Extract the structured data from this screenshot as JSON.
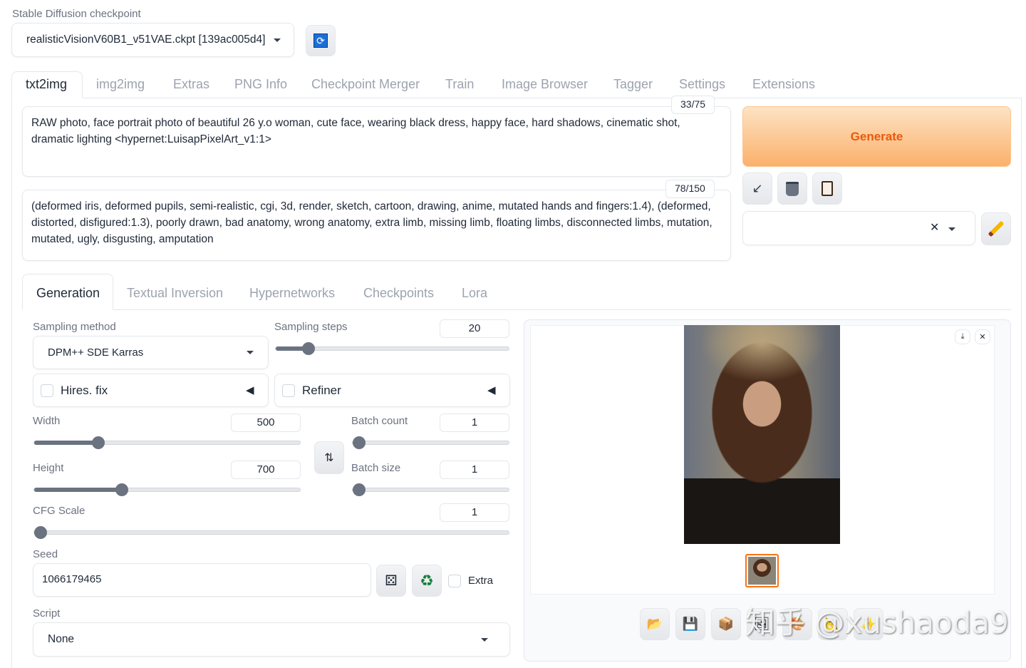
{
  "checkpoint": {
    "label": "Stable Diffusion checkpoint",
    "value": "realisticVisionV60B1_v51VAE.ckpt [139ac005d4]"
  },
  "tabs": [
    "txt2img",
    "img2img",
    "Extras",
    "PNG Info",
    "Checkpoint Merger",
    "Train",
    "Image Browser",
    "Tagger",
    "Settings",
    "Extensions"
  ],
  "prompt": {
    "text": "RAW photo, face portrait photo of beautiful 26 y.o woman, cute face, wearing black dress, happy face, hard shadows, cinematic shot, dramatic lighting <hypernet:LuisapPixelArt_v1:1>",
    "counter": "33/75"
  },
  "negative": {
    "text": "(deformed iris, deformed pupils, semi-realistic, cgi, 3d, render, sketch, cartoon, drawing, anime, mutated hands and fingers:1.4), (deformed, distorted, disfigured:1.3), poorly drawn, bad anatomy, wrong anatomy, extra limb, missing limb, floating limbs, disconnected limbs, mutation, mutated, ugly, disgusting, amputation",
    "counter": "78/150"
  },
  "generate_label": "Generate",
  "subtabs": [
    "Generation",
    "Textual Inversion",
    "Hypernetworks",
    "Checkpoints",
    "Lora"
  ],
  "sampling": {
    "method_label": "Sampling method",
    "method": "DPM++ SDE Karras",
    "steps_label": "Sampling steps",
    "steps": "20",
    "steps_frac": 0.14
  },
  "hires_label": "Hires. fix",
  "refiner_label": "Refiner",
  "width": {
    "label": "Width",
    "value": "500",
    "frac": 0.24
  },
  "height": {
    "label": "Height",
    "value": "700",
    "frac": 0.33
  },
  "batch_count": {
    "label": "Batch count",
    "value": "1",
    "frac": 0
  },
  "batch_size": {
    "label": "Batch size",
    "value": "1",
    "frac": 0
  },
  "cfg": {
    "label": "CFG Scale",
    "value": "1",
    "frac": 0
  },
  "seed": {
    "label": "Seed",
    "value": "1066179465",
    "extra_label": "Extra"
  },
  "script": {
    "label": "Script",
    "value": "None"
  },
  "watermark": "知乎 @xushaoda9"
}
